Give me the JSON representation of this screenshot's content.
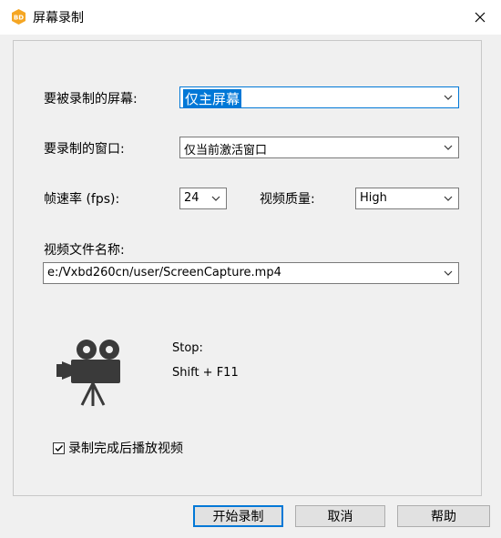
{
  "window": {
    "title": "屏幕录制",
    "app_icon_text": "BD"
  },
  "form": {
    "screen_label": "要被录制的屏幕:",
    "screen_value": "仅主屏幕",
    "window_label": "要录制的窗口:",
    "window_value": "仅当前激活窗口",
    "fps_label": "帧速率 (fps):",
    "fps_value": "24",
    "quality_label": "视频质量:",
    "quality_value": "High",
    "filename_label": "视频文件名称:",
    "filename_value": "e:/Vxbd260cn/user/ScreenCapture.mp4"
  },
  "hotkey": {
    "action": "Stop:",
    "keys": "Shift + F11"
  },
  "options": {
    "play_after_label": "录制完成后播放视频",
    "play_after_checked": true
  },
  "buttons": {
    "start": "开始录制",
    "cancel": "取消",
    "help": "帮助"
  },
  "icons": {
    "app": "bd-app-icon",
    "close": "close-icon",
    "camera": "movie-camera-icon",
    "dropdown": "chevron-down-icon"
  },
  "colors": {
    "accent": "#0078d7",
    "app_icon": "#f5a623"
  }
}
